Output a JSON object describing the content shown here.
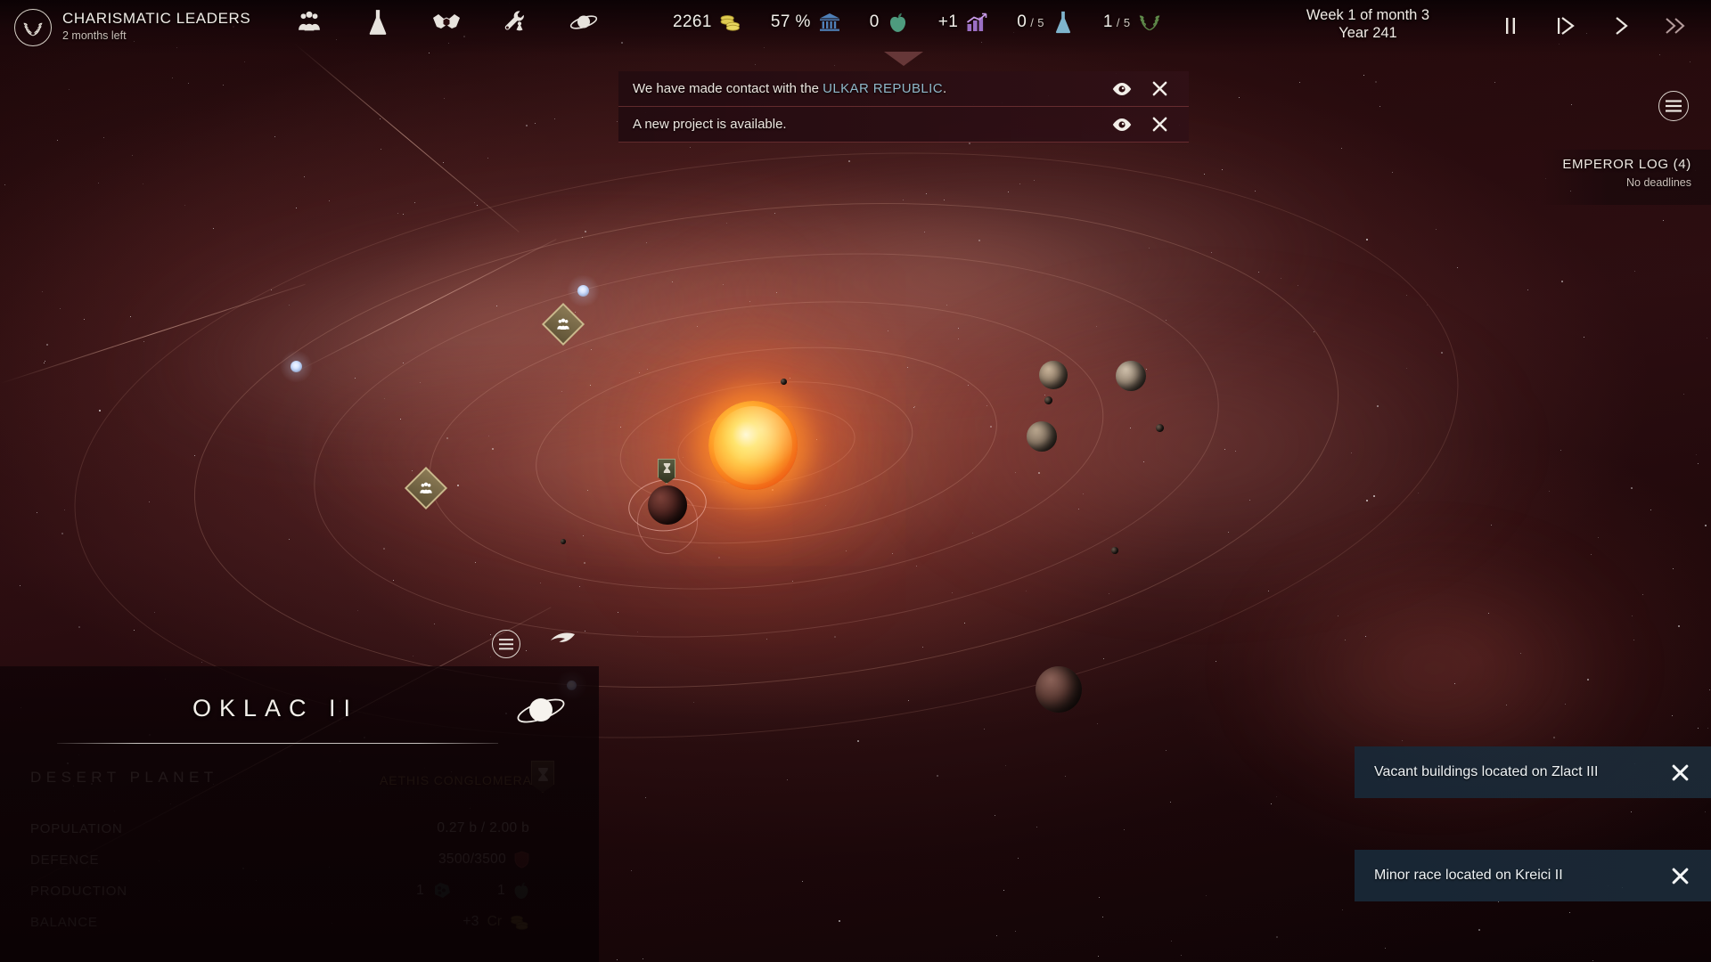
{
  "topbar": {
    "faction_badge_icon": "laurel-wreath-icon",
    "trait": {
      "title": "CHARISMATIC LEADERS",
      "subtitle": "2 months left"
    },
    "category_icons": [
      {
        "name": "population-icon",
        "label": "Population"
      },
      {
        "name": "research-flask-icon",
        "label": "Research"
      },
      {
        "name": "diplomacy-handshake-icon",
        "label": "Diplomacy"
      },
      {
        "name": "shipyard-wrench-icon",
        "label": "Shipyard"
      },
      {
        "name": "planets-icon",
        "label": "Planets"
      }
    ],
    "resources": [
      {
        "name": "credits",
        "value": "2261",
        "icon": "coins-icon"
      },
      {
        "name": "approval",
        "value": "57 %",
        "icon": "senate-icon"
      },
      {
        "name": "food",
        "value": "0",
        "icon": "apple-icon"
      },
      {
        "name": "economy",
        "value": "+1",
        "icon": "growth-chart-icon"
      },
      {
        "name": "research-projects",
        "value": "0",
        "denominator": "/ 5",
        "icon": "flask-icon"
      },
      {
        "name": "traits",
        "value": "1",
        "denominator": "/ 5",
        "icon": "laurel-icon"
      }
    ],
    "date": {
      "line1": "Week 1 of month 3",
      "line2": "Year 241"
    },
    "speed_controls": [
      {
        "name": "pause-button",
        "glyph": "pause"
      },
      {
        "name": "play-step-button",
        "glyph": "play-step"
      },
      {
        "name": "fast-forward-button",
        "glyph": "chevron"
      },
      {
        "name": "fastest-forward-button",
        "glyph": "double-chevron"
      }
    ]
  },
  "banners": {
    "collapse_chevron": "chevron-down-icon",
    "items": [
      {
        "text_before": "We have made contact with the ",
        "highlight": "ULKAR REPUBLIC",
        "text_after": ".",
        "view_icon": "eye-icon",
        "close_icon": "close-icon"
      },
      {
        "text_before": "A new project is available.",
        "highlight": "",
        "text_after": "",
        "view_icon": "eye-icon",
        "close_icon": "close-icon"
      }
    ]
  },
  "right_panel": {
    "menu_icon": "hamburger-menu-icon",
    "emperor_log": {
      "title": "EMPEROR LOG (4)",
      "subtitle": "No deadlines"
    }
  },
  "toasts": [
    {
      "text": "Vacant buildings located on Zlact III",
      "close_icon": "close-icon"
    },
    {
      "text": "Minor race located on Kreici II",
      "close_icon": "close-icon"
    }
  ],
  "planet_panel": {
    "title": "OKLAC II",
    "planet_glyph": "ringed-planet-icon",
    "type": "DESERT PLANET",
    "owner": "AETHIS CONGLOMERATE",
    "owner_flag_icon": "faction-banner-icon",
    "stats": [
      {
        "label": "POPULATION",
        "value": "0.27 b / 2.00 b",
        "icon": ""
      },
      {
        "label": "DEFENCE",
        "value": "3500/3500",
        "icon": "shield-icon"
      },
      {
        "label": "PRODUCTION",
        "value": "1",
        "icon": "minerals-icon",
        "value2": "1",
        "icon2": "apple-icon"
      },
      {
        "label": "BALANCE",
        "value": "+3",
        "unit": "Cr",
        "icon": "coins-icon"
      }
    ]
  },
  "map_controls": {
    "menu_icon": "hamburger-menu-icon",
    "back_icon": "back-arrow-icon"
  },
  "map": {
    "markers": [
      {
        "name": "colony-marker-1",
        "icon": "population-icon"
      },
      {
        "name": "colony-marker-2",
        "icon": "population-icon"
      },
      {
        "name": "fleet-flag-marker",
        "icon": "faction-banner-icon"
      }
    ]
  },
  "colors": {
    "accent_gold": "#b59a5f",
    "accent_blue": "#8fb8c9",
    "toast_bg": "#1c2c3a",
    "banner_bg": "#2c0e14",
    "sun": "#ff9b26"
  }
}
